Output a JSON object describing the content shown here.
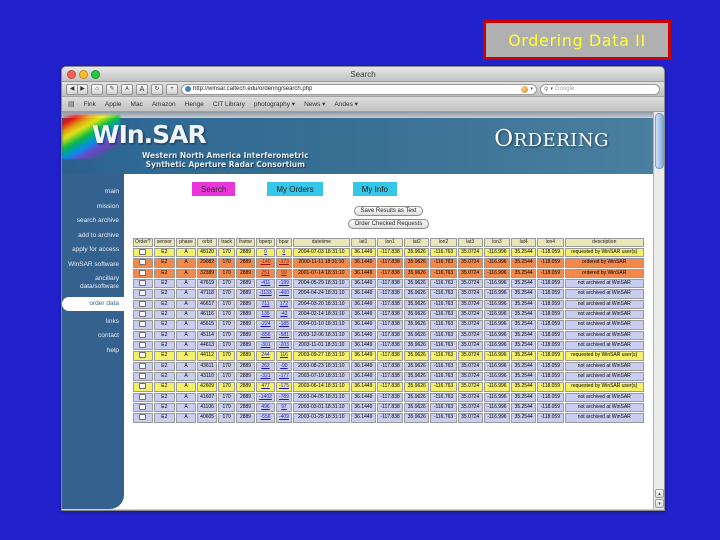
{
  "slide": {
    "title": "Ordering Data II",
    "title_color": "#ffff33",
    "box_bg": "#b0b0b0",
    "box_border": "#cc0000",
    "bg": "#2222cc"
  },
  "browser": {
    "window_title": "Search",
    "url": "http://winsar.caltech.edu/ordering/search.php",
    "search_placeholder": "Google",
    "toolbar": {
      "back": "◀",
      "forward": "▶",
      "home": "⌂",
      "edit": "✎",
      "text_smaller": "A",
      "text_larger": "A",
      "reload": "↻",
      "add": "+",
      "chevron": "▾",
      "magnifier": "⚲"
    },
    "bookmarks": {
      "book_icon": "▤",
      "items": [
        {
          "label": "Fink",
          "menu": false
        },
        {
          "label": "Apple",
          "menu": false
        },
        {
          "label": "Mac",
          "menu": false
        },
        {
          "label": "Amazon",
          "menu": false
        },
        {
          "label": "Henge",
          "menu": false
        },
        {
          "label": "CIT Library",
          "menu": false
        },
        {
          "label": "photography ▾",
          "menu": true
        },
        {
          "label": "News ▾",
          "menu": true
        },
        {
          "label": "Andes ▾",
          "menu": true
        }
      ]
    }
  },
  "banner": {
    "logo": "WIn.SAR",
    "subtitle_line1": "Western North America Interferometric",
    "subtitle_line2": "Synthetic Aperture Radar Consortium",
    "ordering_cap": "O",
    "ordering_rest": "RDERING"
  },
  "sidebar": {
    "items": [
      {
        "label": "main",
        "active": false
      },
      {
        "label": "mission",
        "active": false
      },
      {
        "label": "search archive",
        "active": false
      },
      {
        "label": "add to archive",
        "active": false
      },
      {
        "label": "apply for access",
        "active": false
      },
      {
        "label": "WinSAR software",
        "active": false
      },
      {
        "label": "ancillary data/software",
        "active": false
      },
      {
        "label": "order data",
        "active": true
      },
      {
        "label": "links",
        "active": false
      },
      {
        "label": "contact",
        "active": false
      },
      {
        "label": "help",
        "active": false
      }
    ]
  },
  "tabs": [
    {
      "label": "Search",
      "color": "#e836d8",
      "selected": true
    },
    {
      "label": "My Orders",
      "color": "#36c6e8",
      "selected": false
    },
    {
      "label": "My Info",
      "color": "#36c6e8",
      "selected": false
    }
  ],
  "buttons": {
    "save_results": "Save Results as Text",
    "order_checked": "Order Checked Requests"
  },
  "table": {
    "columns": [
      "Order?",
      "sensor",
      "phase",
      "orbit",
      "track",
      "frame",
      "bperp",
      "bpar",
      "datetime",
      "lat1",
      "lon1",
      "lat2",
      "lon2",
      "lat3",
      "lon3",
      "lat4",
      "lon4",
      "description"
    ],
    "row_legend": {
      "requested": {
        "color": "#f5f06a",
        "text": "requested by WinSAR user(s)"
      },
      "ordered": {
        "color": "#f2884a",
        "text": "ordered by WinSAR"
      },
      "not_archived": {
        "color": "#c9cdf0",
        "text": "not archived at WinSAR"
      }
    },
    "shared": {
      "lat1": "36.1449",
      "lon1": "-117.838",
      "lat2": "35.9626",
      "lon2": "-116.763",
      "lat3": "35.0724",
      "lon3": "-116.996",
      "lat4": "35.2544",
      "lon4": "-118.059",
      "sensor": "E2",
      "phase": "A",
      "track": "170",
      "frame": "2889",
      "time": "18:31:10"
    },
    "rows": [
      {
        "state": "requested",
        "orbit": "48120",
        "bperp": "0",
        "bpar": "0",
        "date": "2004-07-03",
        "description": "requested by WinSAR user(s)"
      },
      {
        "state": "ordered",
        "orbit": "29082",
        "bperp": "-140",
        "bpar": "-173",
        "date": "2000-11-11",
        "description": "ordered by WinSAR"
      },
      {
        "state": "ordered",
        "orbit": "32389",
        "bperp": "251",
        "bpar": "99",
        "date": "2001-07-14",
        "description": "ordered by WinSAR"
      },
      {
        "state": "not_archived",
        "orbit": "47619",
        "bperp": "-411",
        "bpar": "-199",
        "date": "2004-05-29",
        "description": "not archived at WinSAR"
      },
      {
        "state": "not_archived",
        "orbit": "47118",
        "bperp": "-1133",
        "bpar": "-460",
        "date": "2004-04-24",
        "description": "not archived at WinSAR"
      },
      {
        "state": "not_archived",
        "orbit": "46617",
        "bperp": "711",
        "bpar": "172",
        "date": "2004-03-20",
        "description": "not archived at WinSAR"
      },
      {
        "state": "not_archived",
        "orbit": "46116",
        "bperp": "135",
        "bpar": "-42",
        "date": "2004-02-14",
        "description": "not archived at WinSAR"
      },
      {
        "state": "not_archived",
        "orbit": "45615",
        "bperp": "-224",
        "bpar": "-185",
        "date": "2004-01-10",
        "description": "not archived at WinSAR"
      },
      {
        "state": "not_archived",
        "orbit": "45114",
        "bperp": "-856",
        "bpar": "-581",
        "date": "2003-12-06",
        "description": "not archived at WinSAR"
      },
      {
        "state": "not_archived",
        "orbit": "44613",
        "bperp": "-301",
        "bpar": "-203",
        "date": "2003-11-01",
        "description": "not archived at WinSAR"
      },
      {
        "state": "requested",
        "orbit": "44112",
        "bperp": "244",
        "bpar": "116",
        "date": "2003-09-27",
        "description": "requested by WinSAR user(s)"
      },
      {
        "state": "not_archived",
        "orbit": "43611",
        "bperp": "262",
        "bpar": "-90",
        "date": "2003-08-23",
        "description": "not archived at WinSAR"
      },
      {
        "state": "not_archived",
        "orbit": "43110",
        "bperp": "-321",
        "bpar": "-177",
        "date": "2003-07-19",
        "description": "not archived at WinSAR"
      },
      {
        "state": "requested",
        "orbit": "42609",
        "bperp": "477",
        "bpar": "-175",
        "date": "2003-06-14",
        "description": "requested by WinSAR user(s)"
      },
      {
        "state": "not_archived",
        "orbit": "41607",
        "bperp": "-1402",
        "bpar": "-789",
        "date": "2003-04-05",
        "description": "not archived at WinSAR"
      },
      {
        "state": "not_archived",
        "orbit": "41106",
        "bperp": "496",
        "bpar": "97",
        "date": "2003-03-01",
        "description": "not archived at WinSAR"
      },
      {
        "state": "not_archived",
        "orbit": "40605",
        "bperp": "-556",
        "bpar": "-409",
        "date": "2003-01-25",
        "description": "not archived at WinSAR"
      }
    ]
  },
  "scrollbar": {
    "up": "▴",
    "down": "▾"
  }
}
